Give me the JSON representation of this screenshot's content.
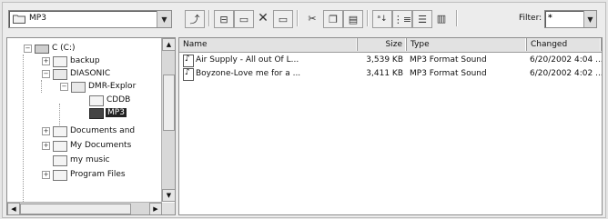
{
  "address": {
    "value": "MP3"
  },
  "filter": {
    "label": "Filter:",
    "value": "*"
  },
  "tree": {
    "items": [
      {
        "label": "C (C:)",
        "kind": "drive",
        "expander": "−"
      },
      {
        "label": "backup",
        "kind": "folder",
        "expander": "+"
      },
      {
        "label": "DIASONIC",
        "kind": "folder",
        "expander": "−"
      },
      {
        "label": "DMR-Explor",
        "kind": "folder",
        "expander": "−"
      },
      {
        "label": "CDDB",
        "kind": "folder",
        "expander": ""
      },
      {
        "label": "MP3",
        "kind": "folder",
        "expander": ""
      },
      {
        "label": "Documents and",
        "kind": "folder",
        "expander": "+"
      },
      {
        "label": "My Documents",
        "kind": "folder",
        "expander": "+"
      },
      {
        "label": "my music",
        "kind": "folder",
        "expander": ""
      },
      {
        "label": "Program Files",
        "kind": "folder",
        "expander": "+"
      }
    ]
  },
  "list": {
    "columns": [
      "Name",
      "Size",
      "Type",
      "Changed"
    ],
    "rows": [
      {
        "name": "Air Supply - All out Of L...",
        "size": "3,539 KB",
        "type": "MP3 Format Sound",
        "changed": "6/20/2002 4:04 ..."
      },
      {
        "name": "Boyzone-Love me for a ...",
        "size": "3,411 KB",
        "type": "MP3 Format Sound",
        "changed": "6/20/2002 4:02 ..."
      }
    ]
  }
}
